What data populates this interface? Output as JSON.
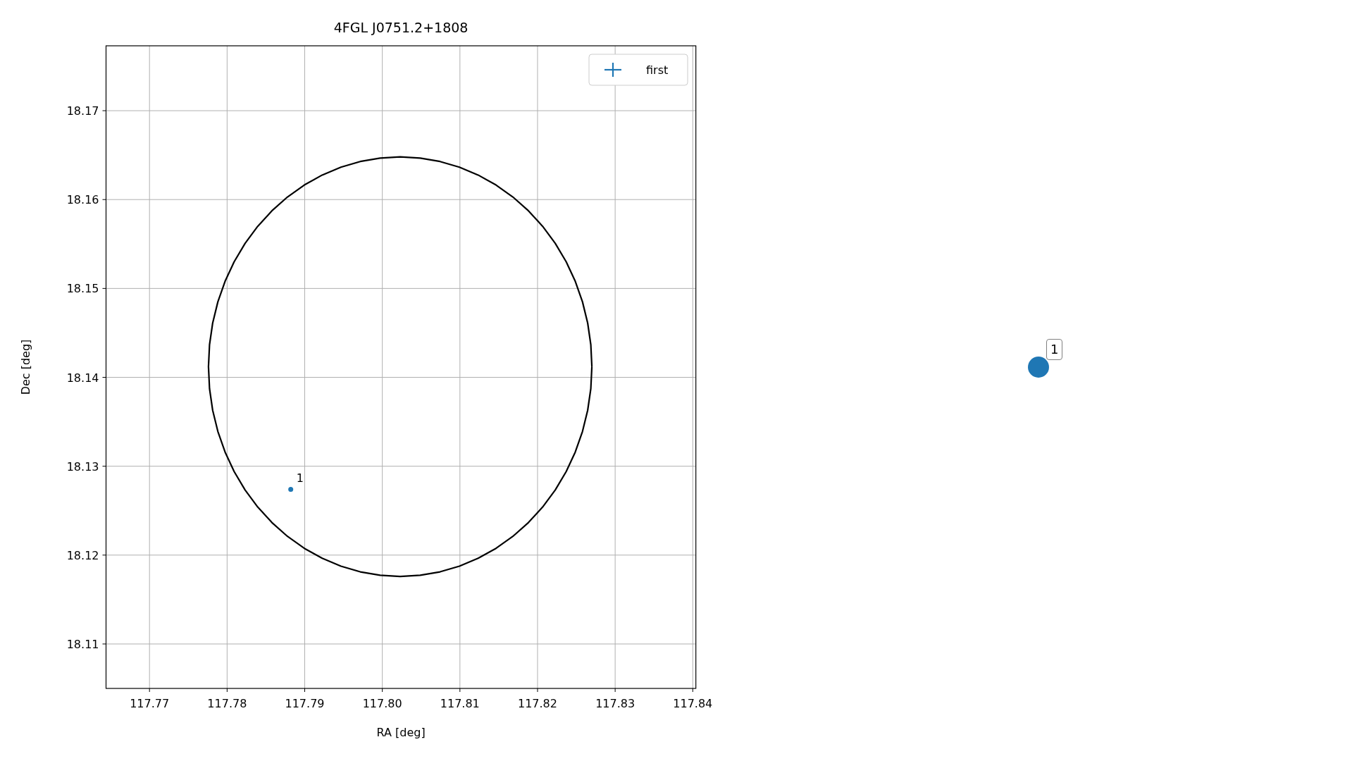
{
  "chart_data": {
    "type": "scatter",
    "title": "4FGL J0751.2+1808",
    "xlabel": "RA [deg]",
    "ylabel": "Dec [deg]",
    "xlim": [
      117.7644,
      117.8404
    ],
    "ylim": [
      18.105,
      18.1773
    ],
    "grid": true,
    "xticks": [
      {
        "value": 117.77,
        "label": "117.77"
      },
      {
        "value": 117.78,
        "label": "117.78"
      },
      {
        "value": 117.79,
        "label": "117.79"
      },
      {
        "value": 117.8,
        "label": "117.80"
      },
      {
        "value": 117.81,
        "label": "117.81"
      },
      {
        "value": 117.82,
        "label": "117.82"
      },
      {
        "value": 117.83,
        "label": "117.83"
      },
      {
        "value": 117.84,
        "label": "117.84"
      }
    ],
    "yticks": [
      {
        "value": 18.11,
        "label": "18.11"
      },
      {
        "value": 18.12,
        "label": "18.12"
      },
      {
        "value": 18.13,
        "label": "18.13"
      },
      {
        "value": 18.14,
        "label": "18.14"
      },
      {
        "value": 18.15,
        "label": "18.15"
      },
      {
        "value": 18.16,
        "label": "18.16"
      },
      {
        "value": 18.17,
        "label": "18.17"
      }
    ],
    "x": [
      117.7882
    ],
    "series": [
      {
        "name": "first",
        "color": "#1f77b4",
        "marker": "o",
        "values": [
          18.1274
        ]
      }
    ],
    "annotations": [
      {
        "x": 117.7882,
        "y": 18.1274,
        "text": "1"
      }
    ]
  },
  "marker": {
    "label": "1",
    "color": "#1f77b4"
  }
}
